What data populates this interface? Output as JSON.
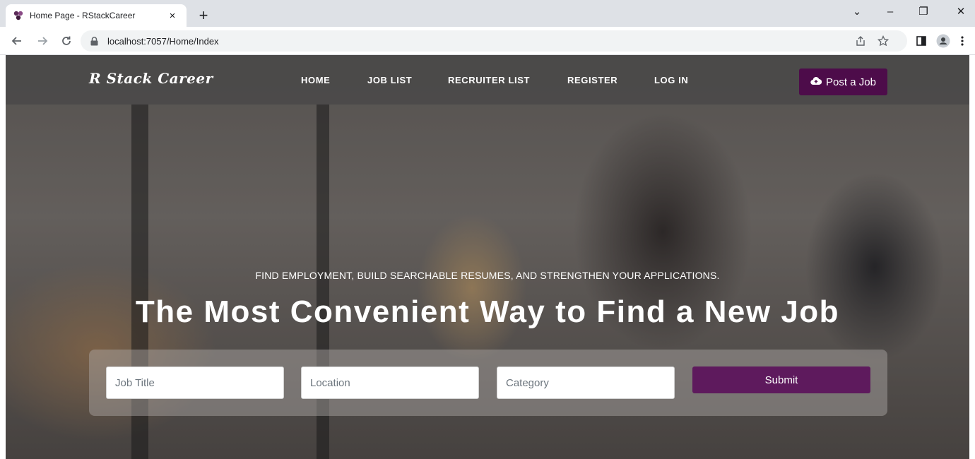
{
  "browser": {
    "tab_title": "Home Page - RStackCareer",
    "tab_close": "×",
    "new_tab": "+",
    "url": "localhost:7057/Home/Index",
    "window_controls": {
      "dropdown": "⌄",
      "minimize": "–",
      "restore": "❐",
      "close": "✕"
    }
  },
  "navbar": {
    "brand": "R Stack Career",
    "links": [
      "HOME",
      "JOB LIST",
      "RECRUITER LIST",
      "REGISTER",
      "LOG IN"
    ],
    "post_job_label": "Post a Job"
  },
  "hero": {
    "tagline": "FIND EMPLOYMENT, BUILD SEARCHABLE RESUMES, AND STRENGTHEN YOUR APPLICATIONS.",
    "headline": "The Most Convenient Way to Find a New Job"
  },
  "search": {
    "job_title_placeholder": "Job Title",
    "location_placeholder": "Location",
    "category_placeholder": "Category",
    "submit_label": "Submit"
  },
  "colors": {
    "brand_purple": "#4d0c4a",
    "submit_purple": "#5e1a5d"
  },
  "icons": [
    "favicon-icon",
    "back-icon",
    "forward-icon",
    "reload-icon",
    "lock-icon",
    "share-icon",
    "star-icon",
    "sidepanel-icon",
    "profile-icon",
    "menu-icon",
    "cloud-upload-icon"
  ]
}
